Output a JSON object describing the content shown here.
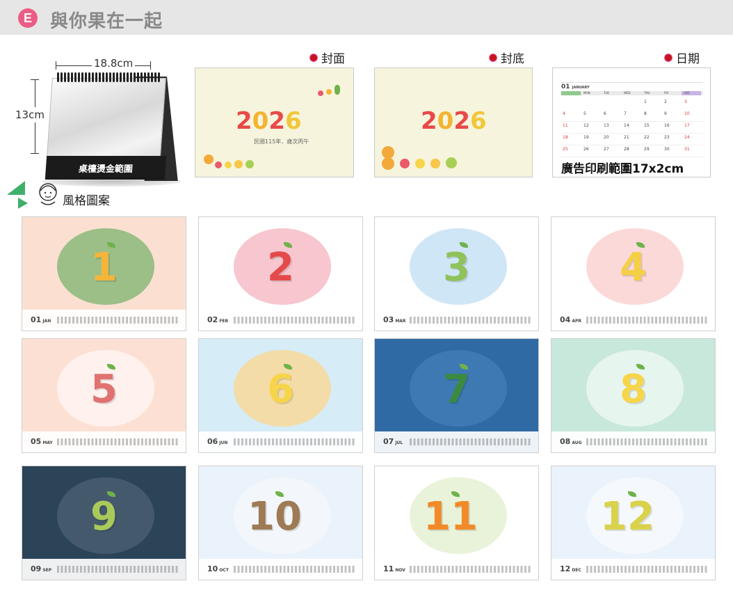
{
  "header": {
    "badge": "E",
    "title": "與你果在一起"
  },
  "desk": {
    "width_label": "18.8cm",
    "height_label": "13cm",
    "foil_label": "桌檯燙金範圍"
  },
  "labels": {
    "cover": "封面",
    "back": "封底",
    "date": "日期",
    "style": "風格圖案"
  },
  "cover": {
    "year": "2026",
    "subtitle": "民國115年．歲次丙午"
  },
  "back": {
    "year": "2026"
  },
  "date_card": {
    "month": "01",
    "month_name": "JANUARY",
    "weekdays": [
      "MON",
      "TUE",
      "WED",
      "THU",
      "FRI",
      "SAT"
    ],
    "rows": [
      [
        "",
        "",
        "",
        "1",
        "2",
        "3"
      ],
      [
        "5",
        "6",
        "7",
        "8",
        "9",
        "10"
      ],
      [
        "12",
        "13",
        "14",
        "15",
        "16",
        "17"
      ],
      [
        "19",
        "20",
        "21",
        "22",
        "23",
        "24"
      ],
      [
        "26",
        "27",
        "28",
        "29",
        "30",
        "31"
      ]
    ],
    "left_col": [
      "4",
      "11",
      "18",
      "25"
    ],
    "ad_text": "廣告印刷範圍17x2cm"
  },
  "months": [
    {
      "num": "1",
      "code": "01",
      "abbr": "JAN"
    },
    {
      "num": "2",
      "code": "02",
      "abbr": "FEB"
    },
    {
      "num": "3",
      "code": "03",
      "abbr": "MAR"
    },
    {
      "num": "4",
      "code": "04",
      "abbr": "APR"
    },
    {
      "num": "5",
      "code": "05",
      "abbr": "MAY"
    },
    {
      "num": "6",
      "code": "06",
      "abbr": "JUN"
    },
    {
      "num": "7",
      "code": "07",
      "abbr": "JUL"
    },
    {
      "num": "8",
      "code": "08",
      "abbr": "AUG"
    },
    {
      "num": "9",
      "code": "09",
      "abbr": "SEP"
    },
    {
      "num": "10",
      "code": "10",
      "abbr": "OCT"
    },
    {
      "num": "11",
      "code": "11",
      "abbr": "NOV"
    },
    {
      "num": "12",
      "code": "12",
      "abbr": "DEC"
    }
  ],
  "colors": {
    "badge": "#ea5d86",
    "accent_red": "#c4161c",
    "cover_bg": "#f6f4dc"
  }
}
